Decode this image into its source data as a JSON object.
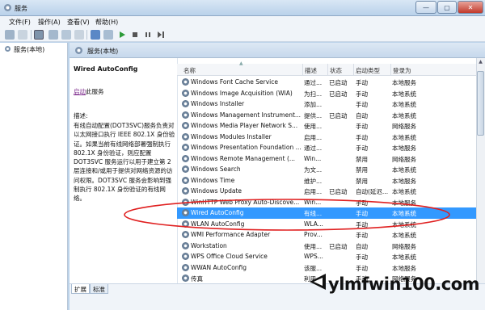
{
  "window": {
    "title": "服务",
    "minimize_symbol": "—",
    "maximize_symbol": "▢",
    "close_symbol": "✕"
  },
  "menu": [
    "文件(F)",
    "操作(A)",
    "查看(V)",
    "帮助(H)"
  ],
  "tree": {
    "item": "服务(本地)"
  },
  "header": {
    "title": "服务(本地)"
  },
  "details": {
    "service_title": "Wired AutoConfig",
    "link_text": "启动",
    "link_suffix": "此服务",
    "desc_label": "描述:",
    "description": "有线自动配置(DOT3SVC)服务负责对以太网接口执行 IEEE 802.1X 身份验证。如果当前有线网络部署强制执行 802.1X 身份验证，则应配置 DOT3SVC 服务运行以用于建立第 2 层连接和/或用于提供对网络资源的访问权限。DOT3SVC 服务会影响到强制执行 802.1X 身份验证的有线网络。"
  },
  "table": {
    "columns": [
      "名称",
      "描述",
      "状态",
      "启动类型",
      "登录为"
    ],
    "rows": [
      {
        "name": "Windows Font Cache Service",
        "desc": "通过...",
        "status": "已启动",
        "startup": "手动",
        "logon": "本地服务",
        "selected": false
      },
      {
        "name": "Windows Image Acquisition (WIA)",
        "desc": "为扫...",
        "status": "已启动",
        "startup": "手动",
        "logon": "本地系统",
        "selected": false
      },
      {
        "name": "Windows Installer",
        "desc": "添加...",
        "status": "",
        "startup": "手动",
        "logon": "本地系统",
        "selected": false
      },
      {
        "name": "Windows Management Instrument...",
        "desc": "提供...",
        "status": "已启动",
        "startup": "自动",
        "logon": "本地系统",
        "selected": false
      },
      {
        "name": "Windows Media Player Network S...",
        "desc": "使用...",
        "status": "",
        "startup": "手动",
        "logon": "网络服务",
        "selected": false
      },
      {
        "name": "Windows Modules Installer",
        "desc": "启用...",
        "status": "",
        "startup": "手动",
        "logon": "本地系统",
        "selected": false
      },
      {
        "name": "Windows Presentation Foundation ...",
        "desc": "通过...",
        "status": "",
        "startup": "手动",
        "logon": "本地服务",
        "selected": false
      },
      {
        "name": "Windows Remote Management (...",
        "desc": "Win...",
        "status": "",
        "startup": "禁用",
        "logon": "网络服务",
        "selected": false
      },
      {
        "name": "Windows Search",
        "desc": "为文...",
        "status": "",
        "startup": "禁用",
        "logon": "本地系统",
        "selected": false
      },
      {
        "name": "Windows Time",
        "desc": "维护...",
        "status": "",
        "startup": "禁用",
        "logon": "本地服务",
        "selected": false
      },
      {
        "name": "Windows Update",
        "desc": "启用...",
        "status": "已启动",
        "startup": "自动(延迟...",
        "logon": "本地系统",
        "selected": false
      },
      {
        "name": "WinHTTP Web Proxy Auto-Discove...",
        "desc": "Win...",
        "status": "",
        "startup": "手动",
        "logon": "本地服务",
        "selected": false
      },
      {
        "name": "Wired AutoConfig",
        "desc": "有线...",
        "status": "",
        "startup": "手动",
        "logon": "本地系统",
        "selected": true
      },
      {
        "name": "WLAN AutoConfig",
        "desc": "WLA...",
        "status": "",
        "startup": "手动",
        "logon": "本地系统",
        "selected": false
      },
      {
        "name": "WMI Performance Adapter",
        "desc": "Prov...",
        "status": "",
        "startup": "手动",
        "logon": "本地系统",
        "selected": false
      },
      {
        "name": "Workstation",
        "desc": "使用...",
        "status": "已启动",
        "startup": "自动",
        "logon": "网络服务",
        "selected": false
      },
      {
        "name": "WPS Office Cloud Service",
        "desc": "WPS...",
        "status": "",
        "startup": "手动",
        "logon": "本地系统",
        "selected": false
      },
      {
        "name": "WWAN AutoConfig",
        "desc": "该服...",
        "status": "",
        "startup": "手动",
        "logon": "本地服务",
        "selected": false
      },
      {
        "name": "传真",
        "desc": "利用...",
        "status": "",
        "startup": "手动",
        "logon": "网络服务",
        "selected": false
      }
    ]
  },
  "tabs": [
    "扩展",
    "标准"
  ],
  "watermark": "ylmfwin100.com",
  "colors": {
    "selection": "#3399ff",
    "annotation": "#e02020",
    "link": "#7d2a8c"
  }
}
